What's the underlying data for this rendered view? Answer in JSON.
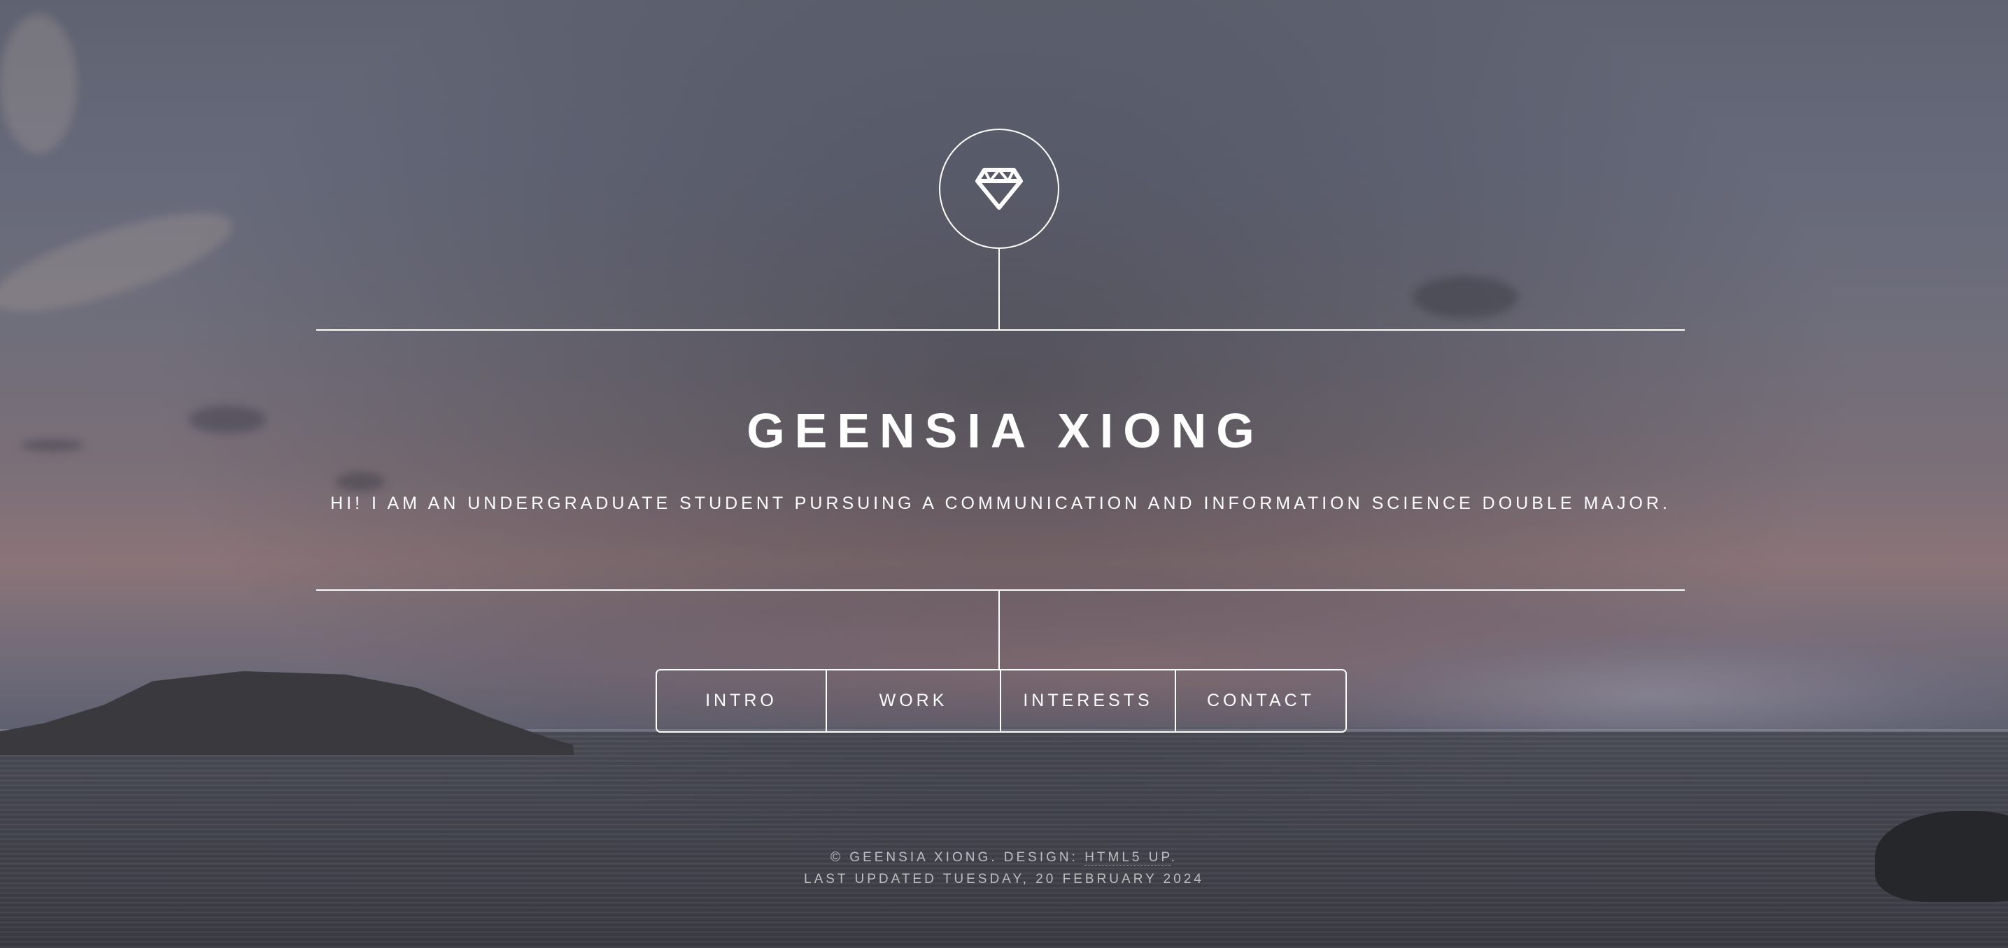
{
  "header": {
    "logo_icon": "diamond-icon",
    "title": "GEENSIA XIONG",
    "subtitle": "HI! I AM AN UNDERGRADUATE STUDENT PURSUING A COMMUNICATION AND INFORMATION SCIENCE DOUBLE MAJOR."
  },
  "nav": {
    "items": [
      {
        "label": "INTRO"
      },
      {
        "label": "WORK"
      },
      {
        "label": "INTERESTS"
      },
      {
        "label": "CONTACT"
      }
    ]
  },
  "footer": {
    "copyright": "© GEENSIA XIONG. DESIGN: ",
    "design_link": "HTML5 UP",
    "copyright_end": ".",
    "last_updated": "LAST UPDATED TUESDAY, 20 FEBRUARY 2024"
  },
  "colors": {
    "foreground": "#ffffff",
    "sky": "#5f6371",
    "sea": "#44464f"
  }
}
